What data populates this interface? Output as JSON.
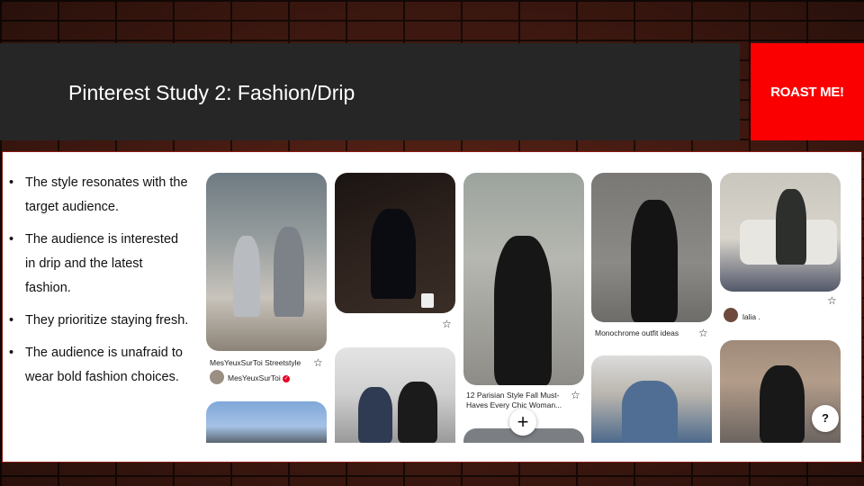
{
  "slide": {
    "title": "Pinterest Study 2: Fashion/Drip",
    "roast_label": "ROAST ME!"
  },
  "bullets": [
    "The style resonates with the target audience.",
    "The audience is interested in drip and the latest fashion.",
    "They prioritize staying fresh.",
    "The audience is unafraid to wear bold fashion choices."
  ],
  "pins": {
    "streetstyle": {
      "title": "MesYeuxSurToi Streetstyle",
      "user": "MesYeuxSurToi"
    },
    "parisian": {
      "title": "12 Parisian Style Fall Must-Haves Every Chic Woman..."
    },
    "monochrome": {
      "title": "Monochrome outfit ideas"
    },
    "lalia": {
      "user": "lalia ."
    }
  },
  "icons": {
    "star": "☆",
    "plus": "+",
    "help": "?",
    "verified": "✓"
  },
  "colors": {
    "header_bg": "#262626",
    "roast_bg": "#fb0000",
    "panel_border": "#8a1a10"
  }
}
